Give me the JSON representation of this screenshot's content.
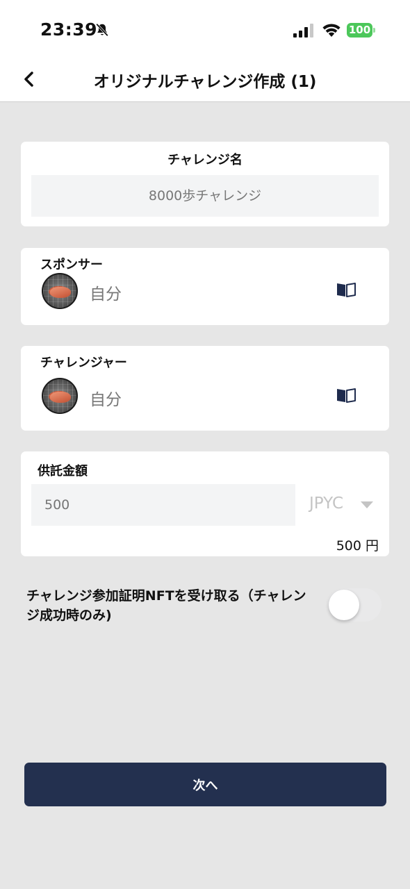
{
  "status_bar": {
    "time": "23:39",
    "battery": "100",
    "icons": [
      "bell-slash-icon",
      "signal-icon",
      "wifi-icon",
      "battery-icon"
    ]
  },
  "nav": {
    "back_icon": "chevron-left-icon",
    "title": "オリジナルチャレンジ作成 (1)"
  },
  "challenge_name": {
    "label": "チャレンジ名",
    "placeholder": "8000歩チャレンジ",
    "value": ""
  },
  "sponsor": {
    "label": "スポンサー",
    "name": "自分",
    "icon": "book-icon"
  },
  "challenger": {
    "label": "チャレンジャー",
    "name": "自分",
    "icon": "book-icon"
  },
  "deposit": {
    "label": "供託金額",
    "placeholder": "500",
    "currency": "JPYC",
    "converted": "500 円"
  },
  "nft_option": {
    "label": "チャレンジ参加証明NFTを受け取る（チャレンジ成功時のみ)",
    "enabled": false
  },
  "next_button": {
    "label": "次へ"
  },
  "colors": {
    "background": "#e6e6e6",
    "primary_button": "#23304f",
    "battery": "#4cc75a",
    "book_icon": "#1e2b4d"
  }
}
